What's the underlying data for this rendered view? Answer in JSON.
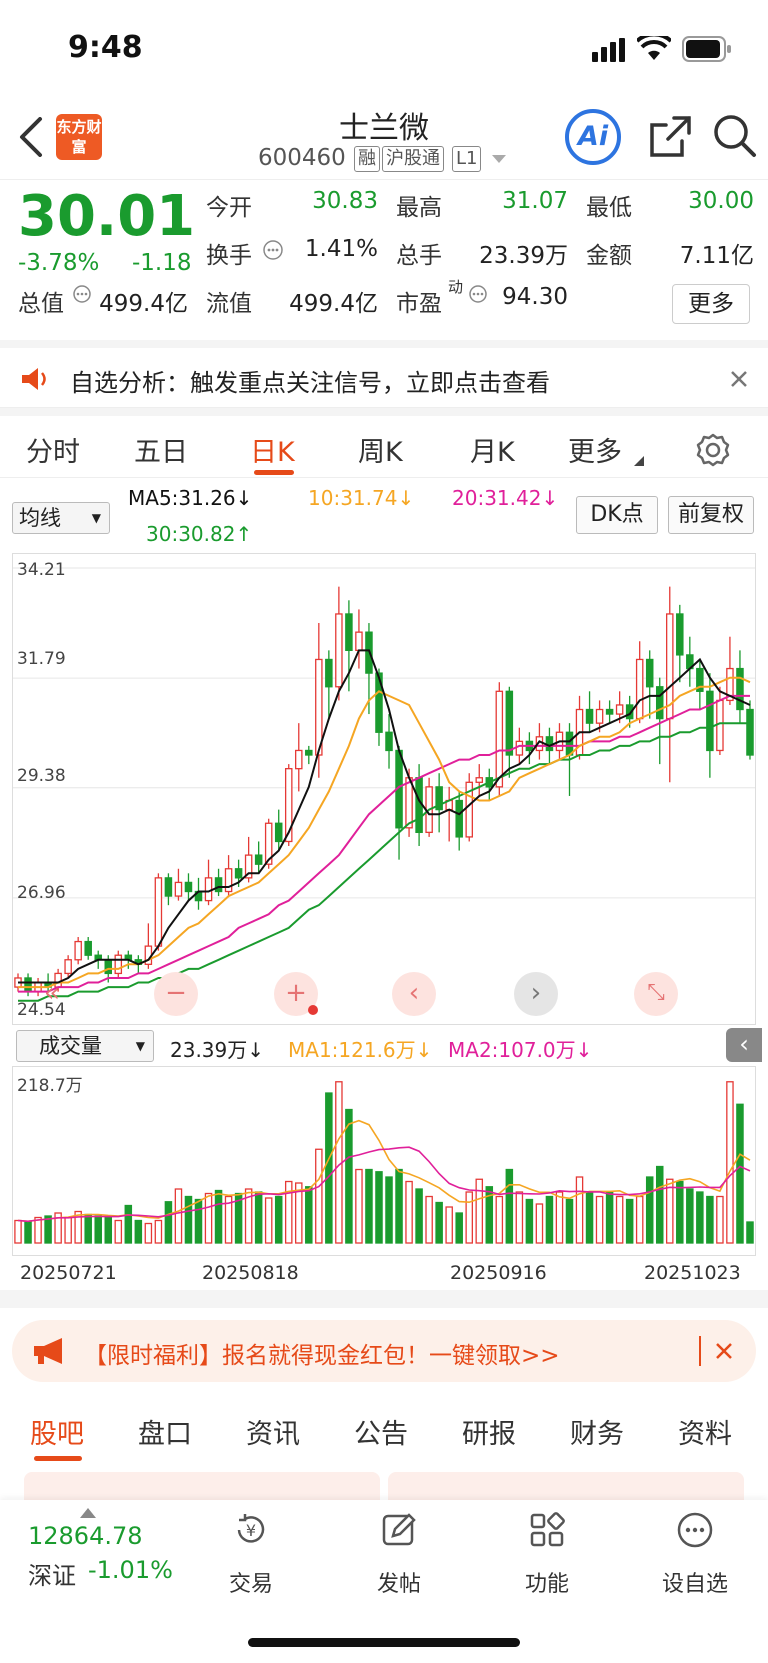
{
  "status": {
    "time": "9:48"
  },
  "header": {
    "logo_text": "东方财富",
    "stock_name": "士兰微",
    "stock_code": "600460",
    "tags": [
      "融",
      "沪股通",
      "L1"
    ],
    "ai_label": "Ai"
  },
  "quote": {
    "price": "30.01",
    "change_pct": "-3.78%",
    "change": "-1.18",
    "fields": {
      "open_label": "今开",
      "open": "30.83",
      "high_label": "最高",
      "high": "31.07",
      "low_label": "最低",
      "low": "30.00",
      "turnover_label": "换手",
      "turnover": "1.41%",
      "volume_label": "总手",
      "volume": "23.39万",
      "amount_label": "金额",
      "amount": "7.11亿",
      "mktcap_label": "总值",
      "mktcap": "499.4亿",
      "float_label": "流值",
      "float": "499.4亿",
      "pe_label": "市盈",
      "pe_sup": "动",
      "pe": "94.30"
    },
    "more_label": "更多"
  },
  "notice": {
    "text": "自选分析：触发重点关注信号，立即点击查看"
  },
  "tabs": [
    "分时",
    "五日",
    "日K",
    "周K",
    "月K",
    "更多"
  ],
  "chart_controls": {
    "indicator": "均线",
    "ma5": "MA5:31.26↓",
    "ma10": "10:31.74↓",
    "ma20": "20:31.42↓",
    "ma30": "30:30.82↑",
    "dk_label": "DK点",
    "adjust_label": "前复权"
  },
  "price_axis": [
    "34.21",
    "31.79",
    "29.38",
    "26.96",
    "24.54"
  ],
  "volume_controls": {
    "indicator": "成交量",
    "vol": "23.39万↓",
    "ma1": "MA1:121.6万↓",
    "ma2": "MA2:107.0万↓",
    "max_label": "218.7万"
  },
  "dates": [
    "20250721",
    "20250818",
    "20250916",
    "20251023"
  ],
  "promo": {
    "text": "【限时福利】报名就得现金红包！一键领取>>"
  },
  "bottom_tabs": [
    "股吧",
    "盘口",
    "资讯",
    "公告",
    "研报",
    "财务",
    "资料"
  ],
  "footer": {
    "index_value": "12864.78",
    "index_name": "深证",
    "index_change": "-1.01%",
    "items": [
      "交易",
      "发帖",
      "功能",
      "设自选"
    ]
  },
  "colors": {
    "up": "#e53935",
    "down": "#1a9b2e",
    "accent": "#e64a19",
    "ma5": "#111111",
    "ma10": "#f5a623",
    "ma20": "#e0209a",
    "ma30": "#1a9b2e"
  },
  "chart_data": {
    "type": "candlestick",
    "ylim": [
      24.54,
      34.21
    ],
    "candles": [
      [
        25.0,
        25.2,
        24.9,
        25.3
      ],
      [
        25.2,
        24.9,
        24.8,
        25.3
      ],
      [
        24.9,
        25.1,
        24.8,
        25.2
      ],
      [
        25.1,
        25.0,
        24.9,
        25.3
      ],
      [
        25.0,
        25.3,
        24.9,
        25.4
      ],
      [
        25.3,
        25.6,
        25.2,
        25.7
      ],
      [
        25.6,
        26.0,
        25.5,
        26.1
      ],
      [
        26.0,
        25.7,
        25.6,
        26.1
      ],
      [
        25.7,
        25.6,
        25.4,
        25.8
      ],
      [
        25.6,
        25.3,
        25.1,
        25.7
      ],
      [
        25.3,
        25.7,
        25.2,
        25.8
      ],
      [
        25.7,
        25.6,
        25.4,
        25.8
      ],
      [
        25.6,
        25.5,
        25.3,
        25.7
      ],
      [
        25.5,
        25.9,
        25.4,
        26.4
      ],
      [
        25.9,
        27.4,
        25.8,
        27.5
      ],
      [
        27.4,
        27.0,
        26.8,
        27.5
      ],
      [
        27.0,
        27.3,
        26.9,
        27.6
      ],
      [
        27.3,
        27.1,
        26.9,
        27.5
      ],
      [
        27.1,
        26.9,
        26.7,
        27.4
      ],
      [
        26.9,
        27.4,
        26.8,
        27.8
      ],
      [
        27.4,
        27.1,
        27.0,
        27.6
      ],
      [
        27.1,
        27.6,
        27.0,
        27.9
      ],
      [
        27.6,
        27.4,
        27.2,
        27.8
      ],
      [
        27.4,
        27.9,
        27.3,
        28.3
      ],
      [
        27.9,
        27.7,
        27.5,
        28.2
      ],
      [
        27.7,
        28.6,
        27.6,
        28.7
      ],
      [
        28.6,
        28.2,
        28.0,
        28.9
      ],
      [
        28.2,
        29.8,
        28.1,
        29.9
      ],
      [
        29.8,
        30.2,
        29.3,
        30.8
      ],
      [
        30.2,
        30.1,
        29.9,
        30.3
      ],
      [
        30.1,
        32.2,
        29.6,
        33.0
      ],
      [
        32.2,
        31.6,
        30.9,
        32.4
      ],
      [
        31.6,
        33.2,
        31.3,
        33.8
      ],
      [
        33.2,
        32.4,
        31.5,
        33.5
      ],
      [
        32.4,
        32.8,
        32.0,
        33.3
      ],
      [
        32.8,
        31.9,
        31.0,
        33.0
      ],
      [
        31.9,
        30.6,
        30.3,
        32.0
      ],
      [
        30.6,
        30.2,
        29.8,
        31.0
      ],
      [
        30.2,
        28.5,
        27.8,
        30.3
      ],
      [
        28.5,
        29.6,
        28.3,
        29.8
      ],
      [
        29.6,
        28.4,
        28.1,
        29.9
      ],
      [
        28.4,
        29.4,
        28.3,
        29.6
      ],
      [
        29.4,
        28.9,
        28.4,
        29.7
      ],
      [
        28.9,
        29.1,
        28.2,
        29.4
      ],
      [
        29.1,
        28.3,
        28.0,
        29.3
      ],
      [
        28.3,
        29.5,
        28.2,
        29.7
      ],
      [
        29.5,
        29.6,
        29.2,
        29.9
      ],
      [
        29.6,
        29.4,
        29.1,
        29.8
      ],
      [
        29.4,
        31.5,
        29.2,
        31.7
      ],
      [
        31.5,
        30.1,
        29.6,
        31.6
      ],
      [
        30.1,
        30.4,
        29.9,
        30.7
      ],
      [
        30.4,
        30.2,
        29.9,
        30.6
      ],
      [
        30.2,
        30.5,
        30.0,
        30.8
      ],
      [
        30.5,
        30.2,
        29.9,
        30.7
      ],
      [
        30.2,
        30.6,
        30.0,
        30.8
      ],
      [
        30.6,
        30.1,
        29.2,
        30.8
      ],
      [
        30.1,
        31.1,
        30.0,
        31.4
      ],
      [
        31.1,
        30.8,
        30.6,
        31.5
      ],
      [
        30.8,
        31.1,
        30.6,
        31.3
      ],
      [
        31.1,
        31.0,
        30.8,
        31.3
      ],
      [
        31.0,
        31.2,
        30.8,
        31.5
      ],
      [
        31.2,
        30.9,
        30.7,
        31.4
      ],
      [
        30.9,
        32.2,
        30.8,
        32.6
      ],
      [
        32.2,
        31.6,
        30.9,
        32.4
      ],
      [
        31.6,
        30.9,
        29.9,
        31.8
      ],
      [
        30.9,
        33.2,
        29.5,
        33.8
      ],
      [
        33.2,
        32.3,
        31.7,
        33.4
      ],
      [
        32.3,
        32.0,
        31.6,
        32.7
      ],
      [
        32.0,
        31.5,
        31.1,
        32.2
      ],
      [
        31.5,
        30.2,
        29.6,
        31.9
      ],
      [
        30.2,
        31.3,
        30.1,
        31.6
      ],
      [
        31.3,
        32.0,
        31.2,
        32.7
      ],
      [
        32.0,
        31.1,
        30.8,
        32.4
      ],
      [
        31.1,
        30.1,
        30.0,
        31.3
      ]
    ],
    "ma5": [
      25.1,
      25.1,
      25.1,
      25.1,
      25.1,
      25.2,
      25.4,
      25.5,
      25.6,
      25.6,
      25.6,
      25.6,
      25.5,
      25.6,
      25.9,
      26.3,
      26.6,
      26.9,
      27.1,
      27.1,
      27.2,
      27.2,
      27.3,
      27.5,
      27.5,
      27.8,
      28.0,
      28.4,
      28.9,
      29.4,
      30.2,
      30.9,
      31.5,
      31.9,
      32.4,
      32.4,
      31.8,
      31.1,
      30.2,
      29.6,
      29.1,
      28.8,
      28.8,
      28.9,
      28.8,
      29.0,
      29.2,
      29.3,
      29.6,
      29.8,
      29.9,
      30.1,
      30.4,
      30.3,
      30.4,
      30.4,
      30.6,
      30.6,
      30.7,
      30.8,
      30.9,
      31.0,
      31.3,
      31.4,
      31.4,
      31.6,
      31.8,
      32.0,
      32.2,
      31.8,
      31.5,
      31.4,
      31.3,
      31.2
    ],
    "ma10": [
      25.0,
      25.0,
      25.0,
      25.0,
      25.1,
      25.1,
      25.2,
      25.3,
      25.3,
      25.4,
      25.4,
      25.5,
      25.5,
      25.6,
      25.7,
      25.9,
      26.1,
      26.3,
      26.4,
      26.6,
      26.8,
      27.0,
      27.1,
      27.2,
      27.3,
      27.5,
      27.7,
      27.9,
      28.2,
      28.5,
      28.9,
      29.3,
      29.8,
      30.3,
      30.9,
      31.3,
      31.5,
      31.4,
      31.3,
      31.2,
      30.8,
      30.4,
      30.0,
      29.5,
      29.3,
      29.2,
      29.1,
      29.1,
      29.2,
      29.3,
      29.6,
      29.7,
      29.8,
      29.9,
      30.0,
      30.1,
      30.3,
      30.4,
      30.5,
      30.5,
      30.6,
      30.8,
      30.9,
      31.0,
      31.1,
      31.2,
      31.4,
      31.5,
      31.6,
      31.6,
      31.7,
      31.8,
      31.8,
      31.7
    ],
    "ma20": [
      24.9,
      24.9,
      24.9,
      24.9,
      25.0,
      25.0,
      25.0,
      25.1,
      25.1,
      25.2,
      25.2,
      25.2,
      25.3,
      25.3,
      25.4,
      25.5,
      25.6,
      25.7,
      25.8,
      25.9,
      26.0,
      26.1,
      26.3,
      26.4,
      26.5,
      26.6,
      26.8,
      26.9,
      27.1,
      27.3,
      27.5,
      27.7,
      27.9,
      28.2,
      28.5,
      28.8,
      29.0,
      29.2,
      29.4,
      29.5,
      29.6,
      29.7,
      29.8,
      29.9,
      30.0,
      30.0,
      30.1,
      30.1,
      30.2,
      30.2,
      30.3,
      30.3,
      30.3,
      30.3,
      30.3,
      30.3,
      30.3,
      30.4,
      30.4,
      30.4,
      30.5,
      30.5,
      30.6,
      30.7,
      30.8,
      30.9,
      31.0,
      31.1,
      31.1,
      31.2,
      31.3,
      31.4,
      31.4,
      31.4
    ],
    "ma30": [
      24.7,
      24.7,
      24.7,
      24.8,
      24.8,
      24.8,
      24.9,
      24.9,
      24.9,
      25.0,
      25.0,
      25.0,
      25.1,
      25.1,
      25.2,
      25.2,
      25.3,
      25.4,
      25.4,
      25.5,
      25.6,
      25.7,
      25.8,
      25.9,
      26.0,
      26.1,
      26.2,
      26.3,
      26.5,
      26.7,
      26.8,
      27.0,
      27.2,
      27.4,
      27.6,
      27.8,
      28.0,
      28.2,
      28.4,
      28.6,
      28.7,
      28.9,
      29.0,
      29.1,
      29.2,
      29.3,
      29.4,
      29.5,
      29.6,
      29.7,
      29.8,
      29.8,
      29.9,
      29.9,
      30.0,
      30.0,
      30.1,
      30.1,
      30.2,
      30.2,
      30.3,
      30.3,
      30.4,
      30.4,
      30.5,
      30.5,
      30.6,
      30.6,
      30.7,
      30.7,
      30.8,
      30.8,
      30.8,
      30.8
    ],
    "volume_ylim": [
      0,
      218.7
    ],
    "volumes": [
      30,
      28,
      34,
      36,
      40,
      34,
      42,
      38,
      36,
      34,
      30,
      50,
      30,
      26,
      30,
      55,
      72,
      62,
      58,
      66,
      70,
      62,
      66,
      72,
      68,
      60,
      62,
      82,
      80,
      75,
      125,
      200,
      215,
      178,
      98,
      98,
      95,
      88,
      98,
      82,
      72,
      62,
      54,
      48,
      40,
      68,
      85,
      75,
      62,
      98,
      68,
      58,
      52,
      62,
      68,
      58,
      88,
      68,
      62,
      68,
      62,
      58,
      62,
      88,
      102,
      85,
      82,
      72,
      68,
      62,
      62,
      215,
      185,
      28
    ]
  }
}
